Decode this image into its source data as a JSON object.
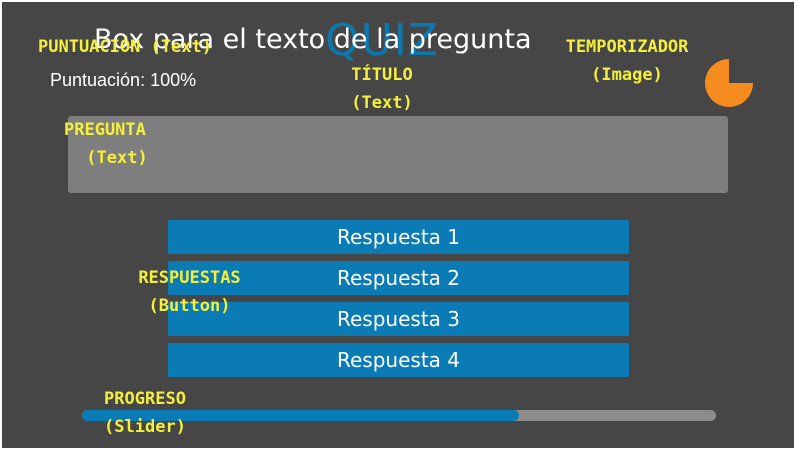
{
  "title": "QUIZ",
  "score": {
    "text": "Puntuación: 100%"
  },
  "question": {
    "text": "Box para el texto de la pregunta"
  },
  "answers": [
    "Respuesta 1",
    "Respuesta 2",
    "Respuesta 3",
    "Respuesta 4"
  ],
  "progress": {
    "value": 0.69
  },
  "timer": {
    "icon": "pie-timer-icon",
    "remaining_fraction": 0.75,
    "color": "#f68b1f"
  },
  "annotations": {
    "score": [
      "PUNTUACIÓN (Text)"
    ],
    "title": [
      "TÍTULO",
      "(Text)"
    ],
    "timer": [
      "TEMPORIZADOR",
      "(Image)"
    ],
    "question": [
      "PREGUNTA",
      "(Text)"
    ],
    "answers": [
      "RESPUESTAS",
      "(Button)"
    ],
    "progress": [
      "PROGRESO",
      "(Slider)"
    ]
  },
  "colors": {
    "background": "#464646",
    "accent": "#0a7bb4",
    "annotation": "#f4f03a",
    "question_box": "#7e7e7e",
    "track": "#8c8c8c"
  }
}
